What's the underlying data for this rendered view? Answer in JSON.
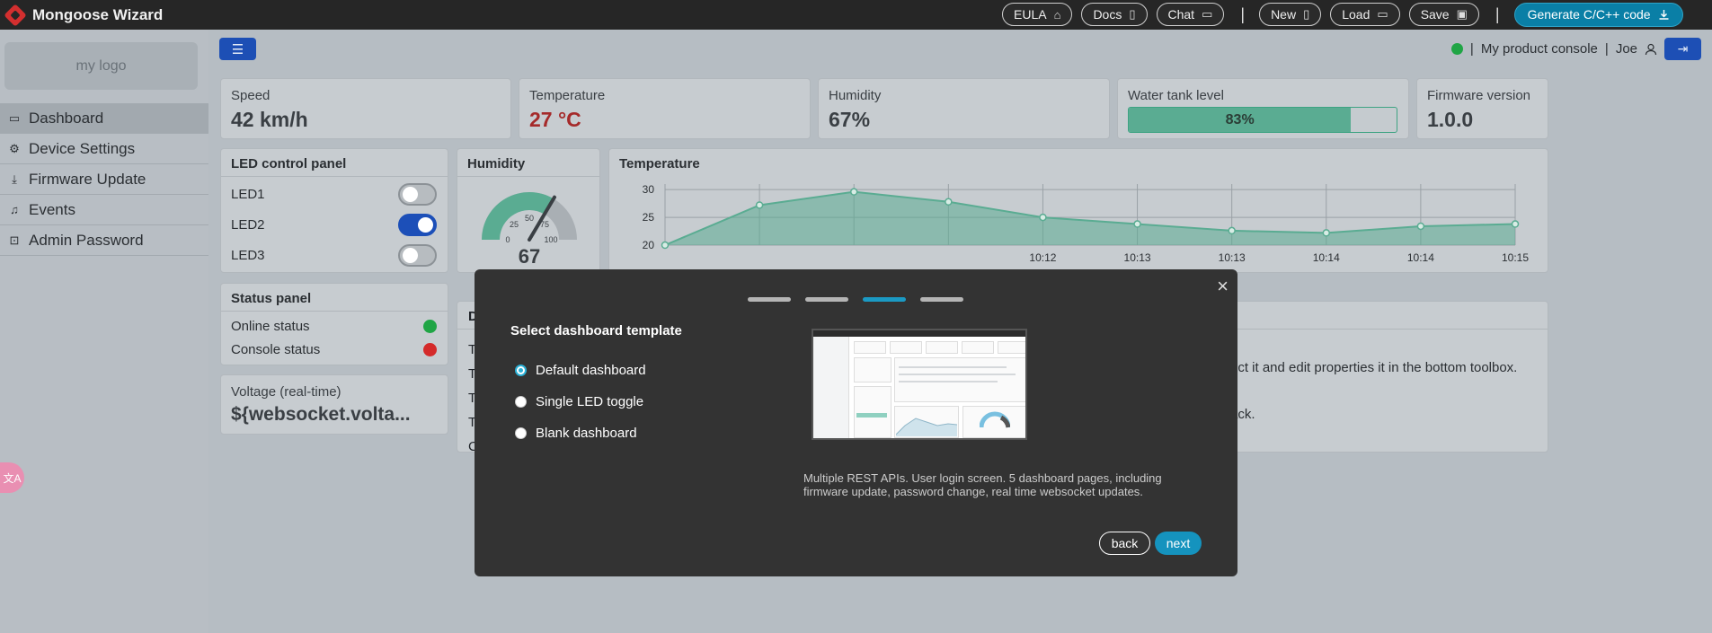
{
  "topbar": {
    "app_title": "Mongoose Wizard",
    "buttons": [
      {
        "label": "EULA",
        "icon": "briefcase-icon",
        "glyph": "⌂"
      },
      {
        "label": "Docs",
        "icon": "book-icon",
        "glyph": "▯"
      },
      {
        "label": "Chat",
        "icon": "chat-icon",
        "glyph": "▭"
      }
    ],
    "file_buttons": [
      {
        "label": "New",
        "icon": "file-icon",
        "glyph": "▯"
      },
      {
        "label": "Load",
        "icon": "folder-icon",
        "glyph": "▭"
      },
      {
        "label": "Save",
        "icon": "save-icon",
        "glyph": "▣"
      }
    ],
    "separator": "|",
    "generate_label": "Generate C/C++ code",
    "generate_icon": "download-icon"
  },
  "sidebar": {
    "logo_text": "my logo",
    "items": [
      {
        "label": "Dashboard",
        "icon": "monitor-icon",
        "glyph": "▭",
        "active": true
      },
      {
        "label": "Device Settings",
        "icon": "gear-icon",
        "glyph": "⚙",
        "active": false
      },
      {
        "label": "Firmware Update",
        "icon": "download-icon",
        "glyph": "⤓",
        "active": false
      },
      {
        "label": "Events",
        "icon": "bell-icon",
        "glyph": "♫",
        "active": false
      },
      {
        "label": "Admin Password",
        "icon": "lock-icon",
        "glyph": "⊡",
        "active": false
      }
    ],
    "lang_icon": "translate-icon",
    "lang_glyph": "文A"
  },
  "header": {
    "console_label": "My product console",
    "user_name": "Joe",
    "separator": "|",
    "status_color": "#20a545"
  },
  "stats": [
    {
      "label": "Speed",
      "value": "42 km/h"
    },
    {
      "label": "Temperature",
      "value": "27 °C",
      "color": "#a52a2a"
    },
    {
      "label": "Humidity",
      "value": "67%"
    },
    {
      "label": "Water tank level",
      "value": "83%",
      "level": 0.83
    },
    {
      "label": "Firmware version",
      "value": "1.0.0"
    }
  ],
  "led_panel": {
    "title": "LED control panel",
    "leds": [
      {
        "label": "LED1",
        "on": false
      },
      {
        "label": "LED2",
        "on": true
      },
      {
        "label": "LED3",
        "on": false
      }
    ]
  },
  "status_panel": {
    "title": "Status panel",
    "items": [
      {
        "label": "Online status",
        "color": "#20a545"
      },
      {
        "label": "Console status",
        "color": "#d42a2a"
      }
    ]
  },
  "voltage_card": {
    "label": "Voltage (real-time)",
    "value": "${websocket.volta..."
  },
  "humidity_gauge": {
    "title": "Humidity",
    "value": "67",
    "value_num": 67,
    "ticks": [
      "0",
      "25",
      "50",
      "75",
      "100"
    ]
  },
  "temperature_chart": {
    "title": "Temperature"
  },
  "chart_data": {
    "type": "area",
    "title": "Temperature",
    "y_ticks": [
      "30",
      "25",
      "20"
    ],
    "ylim": [
      20,
      31
    ],
    "x_tick_labels": [
      "10:12",
      "10:13",
      "10:13",
      "10:14",
      "10:14",
      "10:15"
    ],
    "values": [
      20,
      27.2,
      29.6,
      27.8,
      25.0,
      23.8,
      22.6,
      22.2,
      23.4,
      23.8
    ],
    "color": "#5aac92"
  },
  "background_panel": {
    "visible_text_right_1": "ect it and edit properties it in the bottom toolbox.",
    "visible_text_right_2": "ack.",
    "title_initial": "D",
    "row_initials": [
      "T",
      "T",
      "T",
      "T",
      "C"
    ]
  },
  "modal": {
    "title": "Select dashboard template",
    "steps": [
      false,
      false,
      true,
      false
    ],
    "options": [
      {
        "label": "Default dashboard",
        "checked": true
      },
      {
        "label": "Single LED toggle",
        "checked": false
      },
      {
        "label": "Blank dashboard",
        "checked": false
      }
    ],
    "description": "Multiple REST APIs. User login screen. 5 dashboard pages, including firmware update, password change, real time websocket updates.",
    "back_label": "back",
    "next_label": "next"
  }
}
